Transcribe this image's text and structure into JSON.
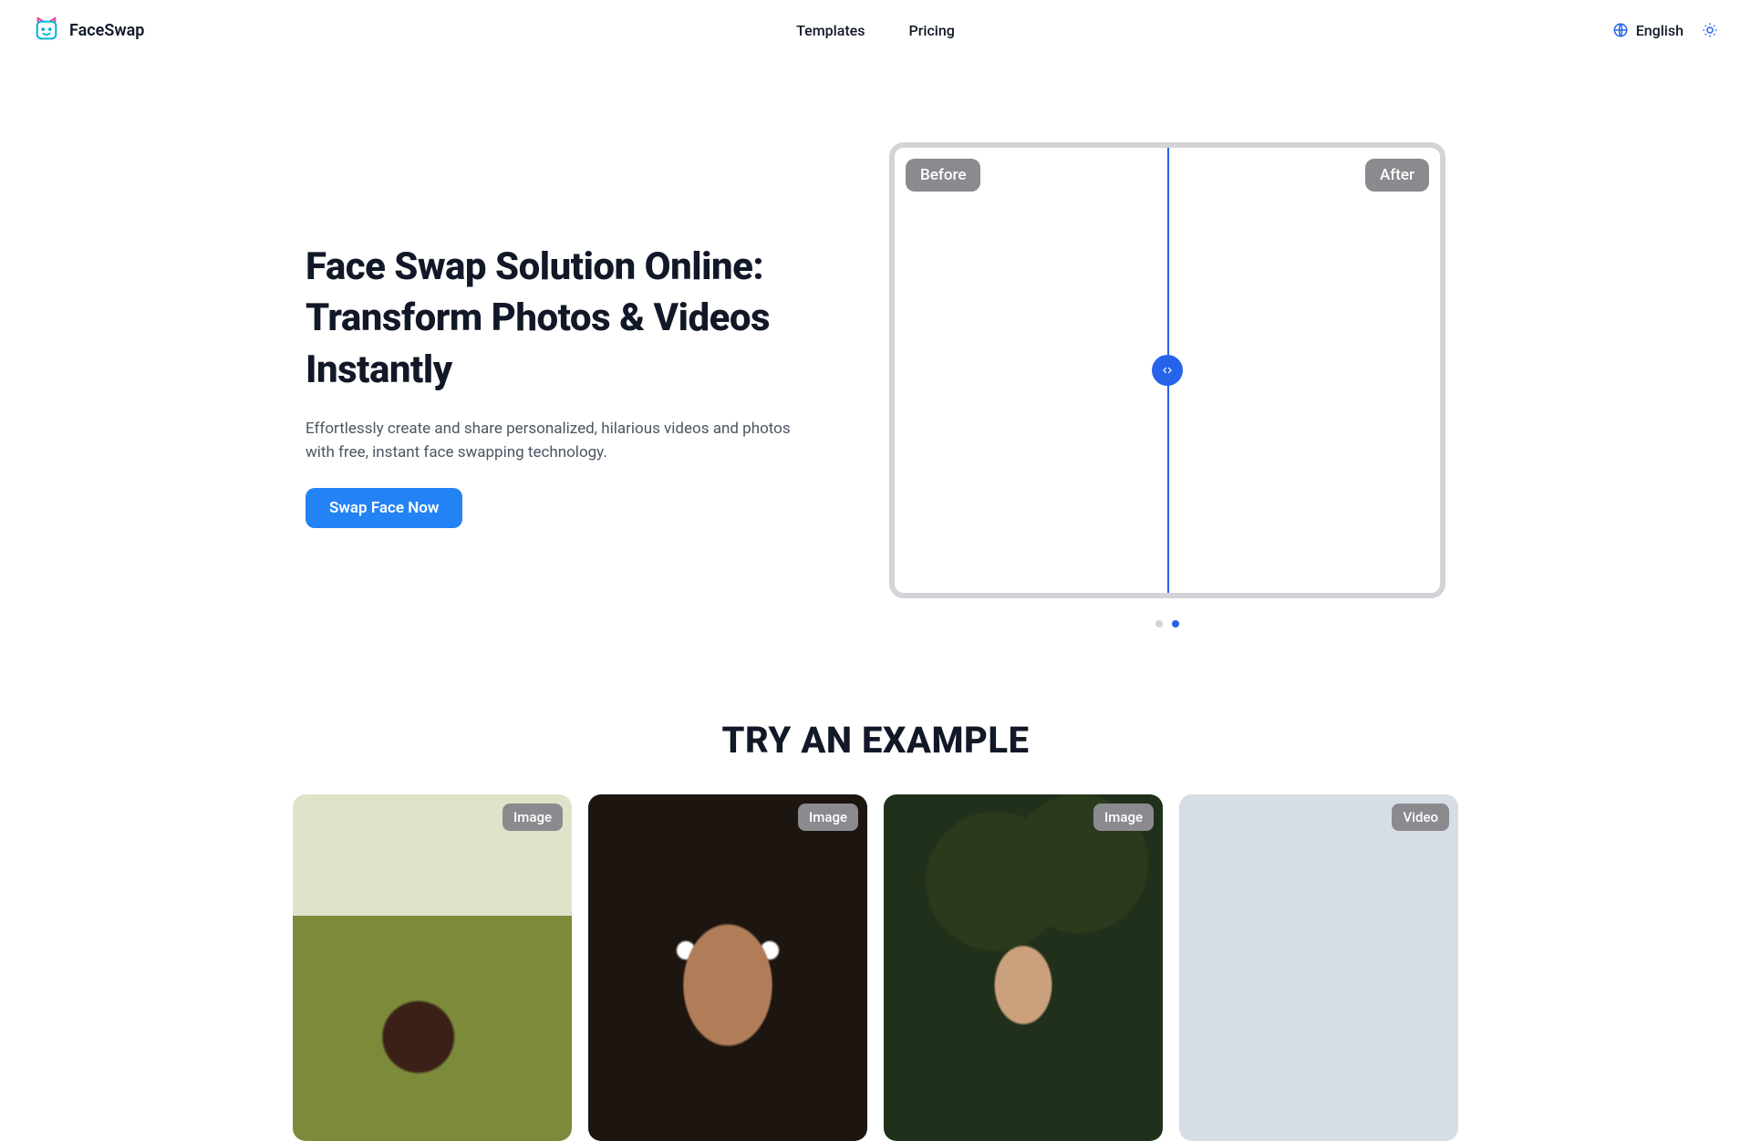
{
  "brand": "FaceSwap",
  "nav": {
    "templates": "Templates",
    "pricing": "Pricing"
  },
  "lang_label": "English",
  "hero": {
    "title": "Face Swap Solution Online: Transform Photos & Videos Instantly",
    "subtitle": "Effortlessly create and share personalized, hilarious videos and photos with free, instant face swapping technology.",
    "cta": "Swap Face Now"
  },
  "compare": {
    "before": "Before",
    "after": "After"
  },
  "examples": {
    "title": "TRY AN EXAMPLE",
    "cards": [
      {
        "type": "Image"
      },
      {
        "type": "Image"
      },
      {
        "type": "Image"
      },
      {
        "type": "Video"
      }
    ]
  },
  "colors": {
    "accent": "#2563eb"
  }
}
